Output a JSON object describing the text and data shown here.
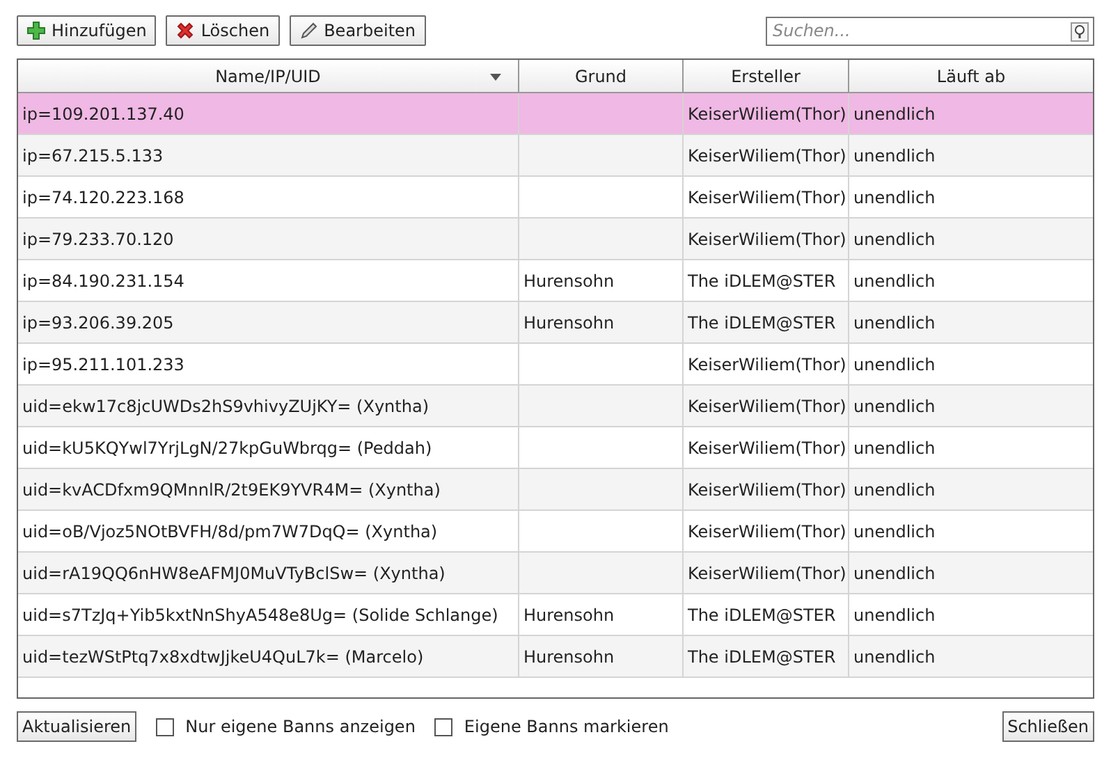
{
  "toolbar": {
    "buttons": [
      {
        "kind": "add",
        "label": "Hinzufügen"
      },
      {
        "kind": "delete",
        "label": "Löschen"
      },
      {
        "kind": "edit",
        "label": "Bearbeiten"
      }
    ]
  },
  "search": {
    "placeholder": "Suchen..."
  },
  "table": {
    "columns": [
      {
        "label": "Name/IP/UID",
        "sorted": true
      },
      {
        "label": "Grund",
        "sorted": false
      },
      {
        "label": "Ersteller",
        "sorted": false
      },
      {
        "label": "Läuft ab",
        "sorted": false
      }
    ],
    "rows": [
      {
        "selected": true,
        "cells": [
          "ip=109.201.137.40",
          "",
          "KeiserWiliem(Thor)",
          "unendlich"
        ]
      },
      {
        "selected": false,
        "cells": [
          "ip=67.215.5.133",
          "",
          "KeiserWiliem(Thor)",
          "unendlich"
        ]
      },
      {
        "selected": false,
        "cells": [
          "ip=74.120.223.168",
          "",
          "KeiserWiliem(Thor)",
          "unendlich"
        ]
      },
      {
        "selected": false,
        "cells": [
          "ip=79.233.70.120",
          "",
          "KeiserWiliem(Thor)",
          "unendlich"
        ]
      },
      {
        "selected": false,
        "cells": [
          "ip=84.190.231.154",
          "Hurensohn",
          "The iDLEM@STER",
          "unendlich"
        ]
      },
      {
        "selected": false,
        "cells": [
          "ip=93.206.39.205",
          "Hurensohn",
          "The iDLEM@STER",
          "unendlich"
        ]
      },
      {
        "selected": false,
        "cells": [
          "ip=95.211.101.233",
          "",
          "KeiserWiliem(Thor)",
          "unendlich"
        ]
      },
      {
        "selected": false,
        "cells": [
          "uid=ekw17c8jcUWDs2hS9vhivyZUjKY= (Xyntha)",
          "",
          "KeiserWiliem(Thor)",
          "unendlich"
        ]
      },
      {
        "selected": false,
        "cells": [
          "uid=kU5KQYwl7YrjLgN/27kpGuWbrqg= (Peddah)",
          "",
          "KeiserWiliem(Thor)",
          "unendlich"
        ]
      },
      {
        "selected": false,
        "cells": [
          "uid=kvACDfxm9QMnnlR/2t9EK9YVR4M= (Xyntha)",
          "",
          "KeiserWiliem(Thor)",
          "unendlich"
        ]
      },
      {
        "selected": false,
        "cells": [
          "uid=oB/Vjoz5NOtBVFH/8d/pm7W7DqQ= (Xyntha)",
          "",
          "KeiserWiliem(Thor)",
          "unendlich"
        ]
      },
      {
        "selected": false,
        "cells": [
          "uid=rA19QQ6nHW8eAFMJ0MuVTyBclSw= (Xyntha)",
          "",
          "KeiserWiliem(Thor)",
          "unendlich"
        ]
      },
      {
        "selected": false,
        "cells": [
          "uid=s7TzJq+Yib5kxtNnShyA548e8Ug= (Solide Schlange)",
          "Hurensohn",
          "The iDLEM@STER",
          "unendlich"
        ]
      },
      {
        "selected": false,
        "cells": [
          "uid=tezWStPtq7x8xdtwJjkeU4QuL7k= (Marcelo)",
          "Hurensohn",
          "The iDLEM@STER",
          "unendlich"
        ]
      }
    ]
  },
  "footer": {
    "refresh": "Aktualisieren",
    "checkboxes": [
      {
        "label": "Nur eigene Banns anzeigen",
        "checked": false
      },
      {
        "label": "Eigene Banns markieren",
        "checked": false
      }
    ],
    "close": "Schließen"
  }
}
